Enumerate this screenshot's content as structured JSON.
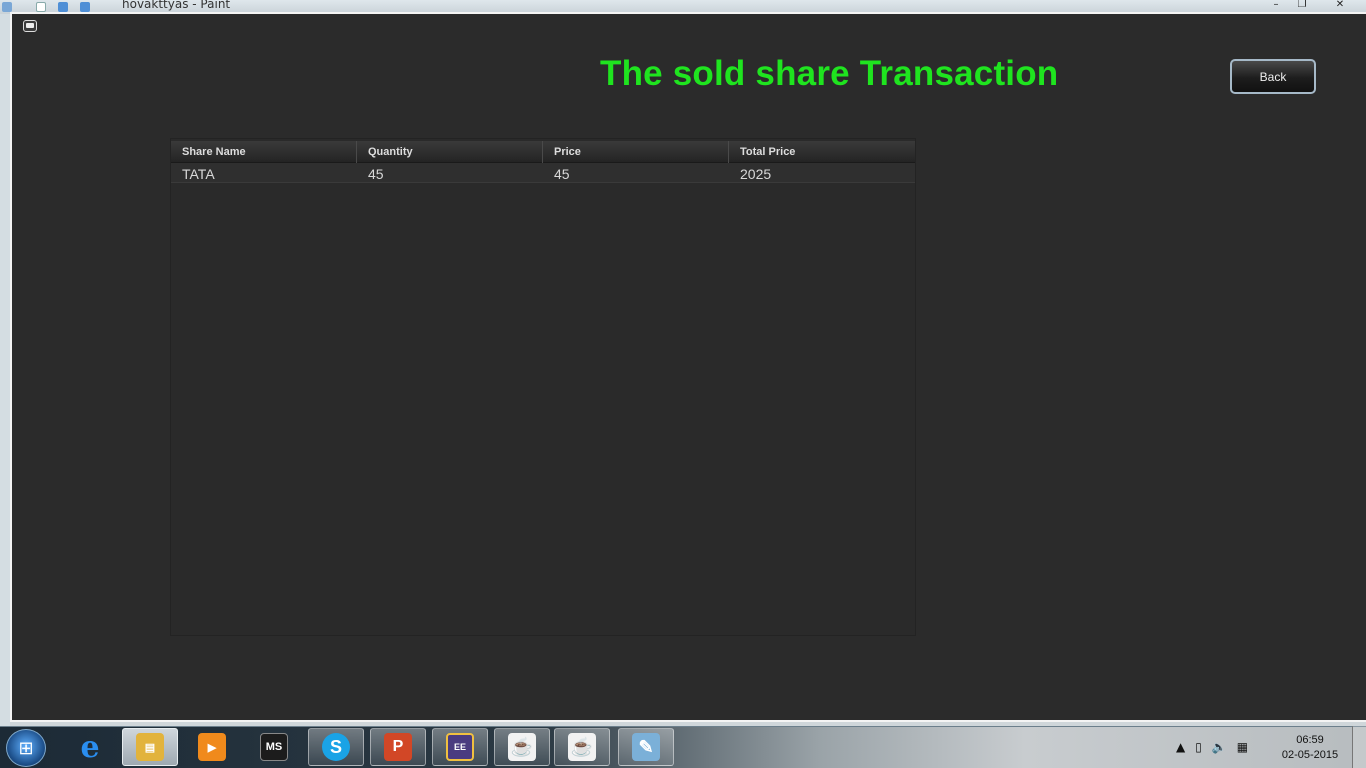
{
  "background_window": {
    "title": "hovakttyas - Paint",
    "controls": [
      "–",
      "❐",
      "✕"
    ]
  },
  "app": {
    "title": "The sold share Transaction",
    "back_label": "Back",
    "title_color": "#1fe41f"
  },
  "table": {
    "columns": [
      "Share Name",
      "Quantity",
      "Price",
      "Total Price"
    ],
    "rows": [
      [
        "TATA",
        "45",
        "45",
        "2025"
      ]
    ]
  },
  "taskbar": {
    "start_icon": "windows-start-icon",
    "items": [
      {
        "name": "internet-explorer-icon",
        "glyph": "e",
        "color": "#2a8ef0"
      },
      {
        "name": "file-explorer-icon",
        "glyph": "▤",
        "color": "#e2b33c",
        "active": true
      },
      {
        "name": "media-player-icon",
        "glyph": "▶",
        "color": "#f08a1c"
      },
      {
        "name": "ms-office-icon",
        "glyph": "MS",
        "color": "#222222"
      },
      {
        "name": "skype-icon",
        "glyph": "S",
        "color": "#1aa3e6"
      },
      {
        "name": "powerpoint-icon",
        "glyph": "P",
        "color": "#d24726"
      },
      {
        "name": "java-ee-ide-icon",
        "glyph": "EE",
        "color": "#4a3b80"
      },
      {
        "name": "java-icon-1",
        "glyph": "☕",
        "color": "#e0e0e0"
      },
      {
        "name": "java-icon-2",
        "glyph": "☕",
        "color": "#e0e0e0"
      },
      {
        "name": "paint-icon",
        "glyph": "🎨",
        "color": "#7bb0d8"
      }
    ],
    "tray": {
      "time": "06:59",
      "date": "02-05-2015"
    }
  }
}
